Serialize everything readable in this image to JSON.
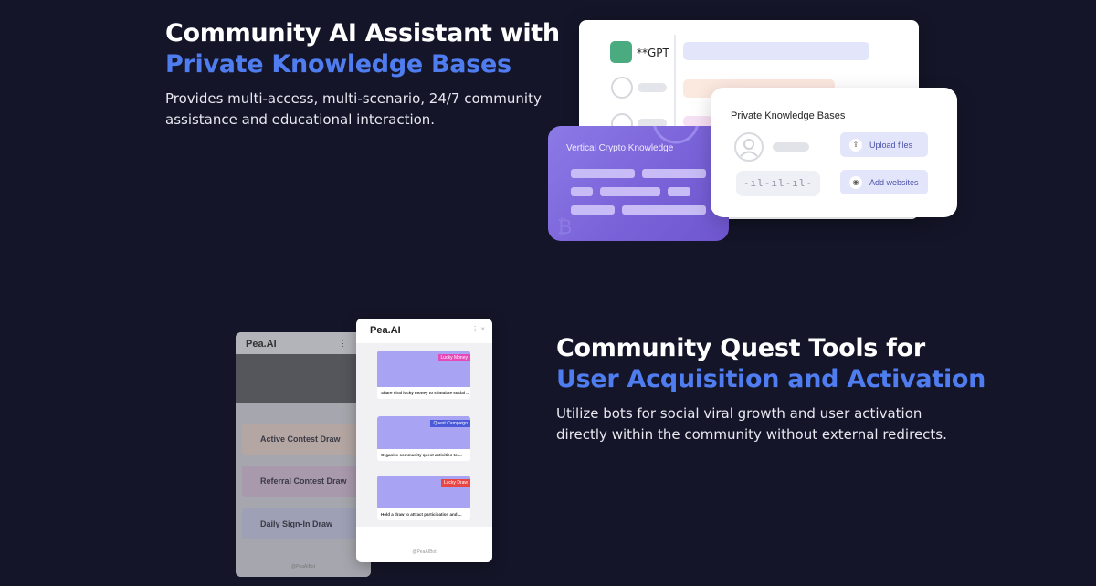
{
  "section1": {
    "title_line1": "Community AI Assistant with",
    "title_accent": "Private Knowledge Bases",
    "description_line1": "Provides multi-access, multi-scenario, 24/7 community",
    "description_line2": "assistance and educational interaction.",
    "illustration": {
      "gpt_label": "**GPT",
      "crypto_card_title": "Vertical Crypto Knowledge",
      "kb_card_title": "Private Knowledge Bases",
      "upload_button": "Upload files",
      "add_websites_button": "Add websites",
      "voice_wave": "-ıl-ıl-ıl-",
      "upload_icon": "upload-icon",
      "globe_icon": "globe-icon"
    }
  },
  "section2": {
    "title_line1": "Community Quest Tools for",
    "title_accent": "User Acquisition and Activation",
    "description_line1": "Utilize bots for social viral growth and user activation",
    "description_line2": "directly within the community without external redirects.",
    "back_phone": {
      "title": "Pea.AI",
      "menu_glyph": "⋮",
      "items": [
        "Active Contest Draw",
        "Referral Contest Draw",
        "Daily Sign-In Draw"
      ],
      "footer": "@PeaAIBot"
    },
    "front_phone": {
      "title": "Pea.AI",
      "icons": "⋮  ×",
      "cards": [
        {
          "badge": "Lucky Money",
          "text": "Share viral lucky money to stimulate social ..."
        },
        {
          "badge": "Quest Campaign",
          "text": "Organize community quest activities to ..."
        },
        {
          "badge": "Lucky Draw",
          "text": "Hold a draw to attract participation and ..."
        }
      ],
      "footer": "@PeaAIBot"
    }
  },
  "colors": {
    "background": "#141528",
    "accent": "#4f7df0",
    "crypto_card": "#7a63d9",
    "gpt_logo": "#4aab80",
    "badge_lucky_money": "#e64ab8",
    "badge_quest_campaign": "#4a5ad8",
    "badge_lucky_draw": "#e84545"
  }
}
